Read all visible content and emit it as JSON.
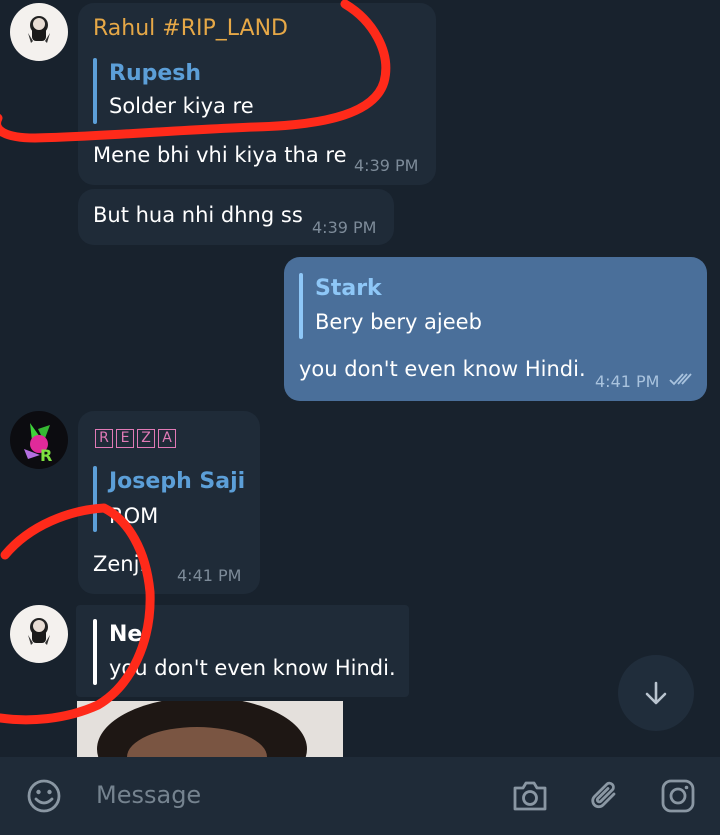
{
  "messages": [
    {
      "sender": "Rahul #RIP_LAND",
      "reply_to": "Rupesh",
      "reply_text": "Solder kiya re",
      "text": "Mene bhi vhi kiya tha re",
      "time": "4:39 PM"
    },
    {
      "text": "But hua nhi dhng ss",
      "time": "4:39 PM"
    },
    {
      "reply_to": "Stark",
      "reply_text": "Bery bery ajeeb",
      "text": "you don't even know Hindi.",
      "time": "4:41 PM",
      "status": "read"
    },
    {
      "sender_letters": [
        "R",
        "E",
        "Z",
        "A"
      ],
      "reply_to": "Joseph Saji",
      "reply_text": "ROM",
      "text": "Zenji",
      "time": "4:41 PM"
    },
    {
      "reply_to": "Ne",
      "reply_text": "you don't even know Hindi."
    }
  ],
  "composer": {
    "placeholder": "Message"
  },
  "colors": {
    "background": "#18222d",
    "incoming_bubble": "#1f2b38",
    "outgoing_bubble": "#4a6f9a",
    "accent_blue": "#5c9fd8",
    "sender_orange": "#e6a847",
    "annotation_red": "#ff2a1a"
  },
  "icons": [
    "emoji-icon",
    "camera-icon",
    "attach-icon",
    "instagram-icon",
    "arrow-down-icon",
    "double-check-icon"
  ]
}
